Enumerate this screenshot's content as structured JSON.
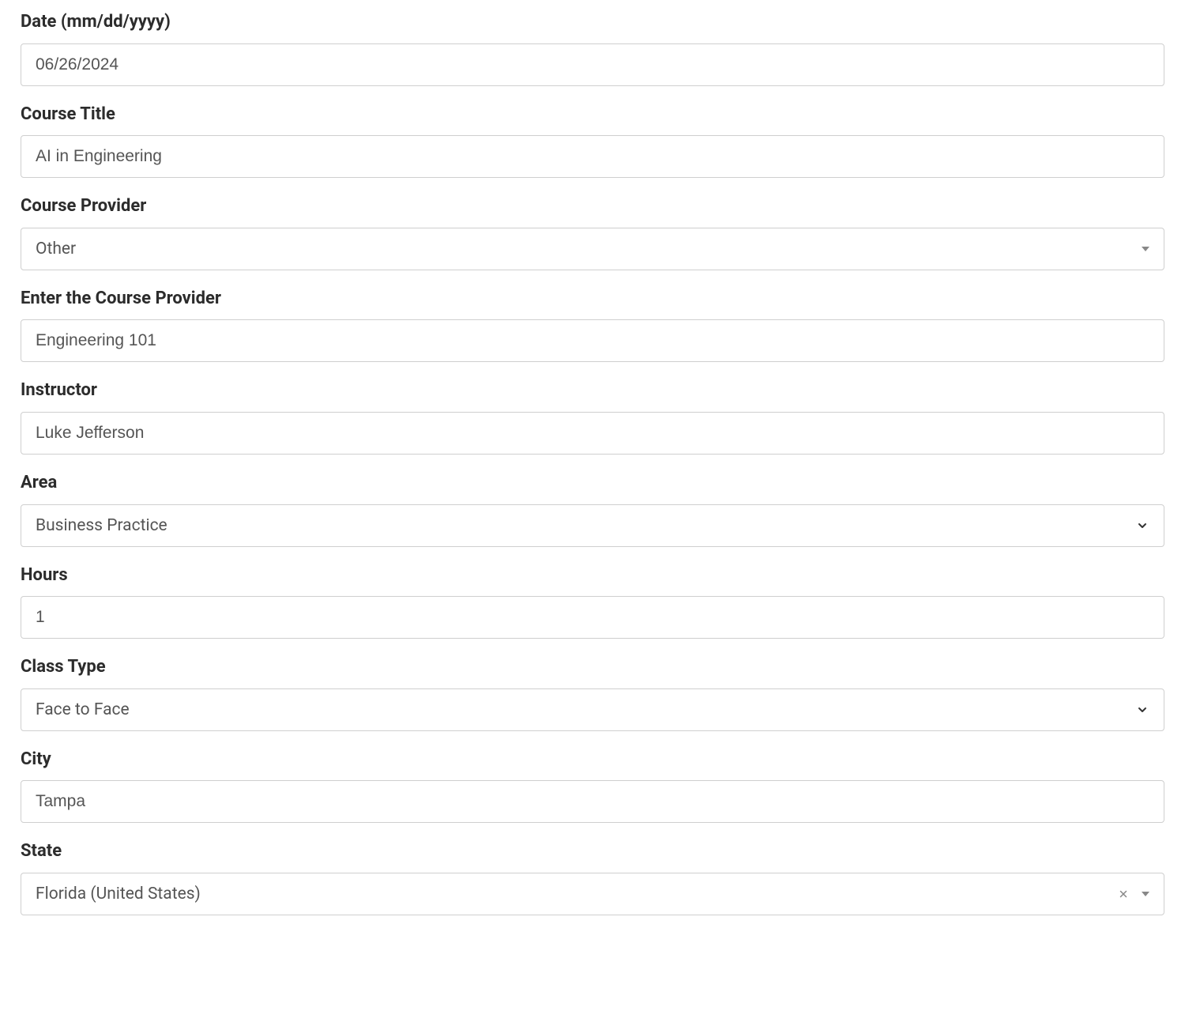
{
  "form": {
    "date": {
      "label": "Date (mm/dd/yyyy)",
      "value": "06/26/2024"
    },
    "courseTitle": {
      "label": "Course Title",
      "value": "AI in Engineering"
    },
    "courseProvider": {
      "label": "Course Provider",
      "value": "Other"
    },
    "enterProvider": {
      "label": "Enter the Course Provider",
      "value": "Engineering 101"
    },
    "instructor": {
      "label": "Instructor",
      "value": "Luke Jefferson"
    },
    "area": {
      "label": "Area",
      "value": "Business Practice"
    },
    "hours": {
      "label": "Hours",
      "value": "1"
    },
    "classType": {
      "label": "Class Type",
      "value": "Face to Face"
    },
    "city": {
      "label": "City",
      "value": "Tampa"
    },
    "state": {
      "label": "State",
      "value": "Florida (United States)"
    }
  }
}
